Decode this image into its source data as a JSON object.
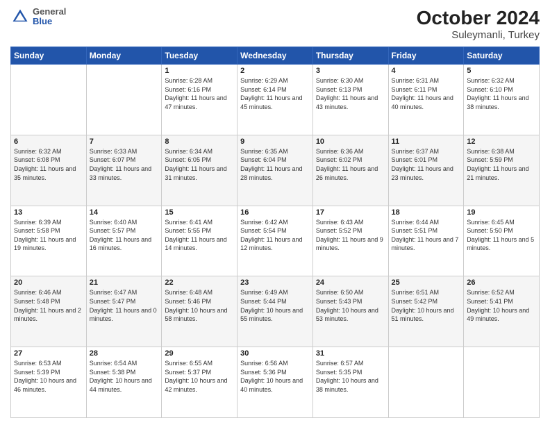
{
  "header": {
    "logo_general": "General",
    "logo_blue": "Blue",
    "title": "October 2024",
    "subtitle": "Suleymanli, Turkey"
  },
  "weekdays": [
    "Sunday",
    "Monday",
    "Tuesday",
    "Wednesday",
    "Thursday",
    "Friday",
    "Saturday"
  ],
  "weeks": [
    [
      {
        "day": "",
        "info": ""
      },
      {
        "day": "",
        "info": ""
      },
      {
        "day": "1",
        "info": "Sunrise: 6:28 AM\nSunset: 6:16 PM\nDaylight: 11 hours and 47 minutes."
      },
      {
        "day": "2",
        "info": "Sunrise: 6:29 AM\nSunset: 6:14 PM\nDaylight: 11 hours and 45 minutes."
      },
      {
        "day": "3",
        "info": "Sunrise: 6:30 AM\nSunset: 6:13 PM\nDaylight: 11 hours and 43 minutes."
      },
      {
        "day": "4",
        "info": "Sunrise: 6:31 AM\nSunset: 6:11 PM\nDaylight: 11 hours and 40 minutes."
      },
      {
        "day": "5",
        "info": "Sunrise: 6:32 AM\nSunset: 6:10 PM\nDaylight: 11 hours and 38 minutes."
      }
    ],
    [
      {
        "day": "6",
        "info": "Sunrise: 6:32 AM\nSunset: 6:08 PM\nDaylight: 11 hours and 35 minutes."
      },
      {
        "day": "7",
        "info": "Sunrise: 6:33 AM\nSunset: 6:07 PM\nDaylight: 11 hours and 33 minutes."
      },
      {
        "day": "8",
        "info": "Sunrise: 6:34 AM\nSunset: 6:05 PM\nDaylight: 11 hours and 31 minutes."
      },
      {
        "day": "9",
        "info": "Sunrise: 6:35 AM\nSunset: 6:04 PM\nDaylight: 11 hours and 28 minutes."
      },
      {
        "day": "10",
        "info": "Sunrise: 6:36 AM\nSunset: 6:02 PM\nDaylight: 11 hours and 26 minutes."
      },
      {
        "day": "11",
        "info": "Sunrise: 6:37 AM\nSunset: 6:01 PM\nDaylight: 11 hours and 23 minutes."
      },
      {
        "day": "12",
        "info": "Sunrise: 6:38 AM\nSunset: 5:59 PM\nDaylight: 11 hours and 21 minutes."
      }
    ],
    [
      {
        "day": "13",
        "info": "Sunrise: 6:39 AM\nSunset: 5:58 PM\nDaylight: 11 hours and 19 minutes."
      },
      {
        "day": "14",
        "info": "Sunrise: 6:40 AM\nSunset: 5:57 PM\nDaylight: 11 hours and 16 minutes."
      },
      {
        "day": "15",
        "info": "Sunrise: 6:41 AM\nSunset: 5:55 PM\nDaylight: 11 hours and 14 minutes."
      },
      {
        "day": "16",
        "info": "Sunrise: 6:42 AM\nSunset: 5:54 PM\nDaylight: 11 hours and 12 minutes."
      },
      {
        "day": "17",
        "info": "Sunrise: 6:43 AM\nSunset: 5:52 PM\nDaylight: 11 hours and 9 minutes."
      },
      {
        "day": "18",
        "info": "Sunrise: 6:44 AM\nSunset: 5:51 PM\nDaylight: 11 hours and 7 minutes."
      },
      {
        "day": "19",
        "info": "Sunrise: 6:45 AM\nSunset: 5:50 PM\nDaylight: 11 hours and 5 minutes."
      }
    ],
    [
      {
        "day": "20",
        "info": "Sunrise: 6:46 AM\nSunset: 5:48 PM\nDaylight: 11 hours and 2 minutes."
      },
      {
        "day": "21",
        "info": "Sunrise: 6:47 AM\nSunset: 5:47 PM\nDaylight: 11 hours and 0 minutes."
      },
      {
        "day": "22",
        "info": "Sunrise: 6:48 AM\nSunset: 5:46 PM\nDaylight: 10 hours and 58 minutes."
      },
      {
        "day": "23",
        "info": "Sunrise: 6:49 AM\nSunset: 5:44 PM\nDaylight: 10 hours and 55 minutes."
      },
      {
        "day": "24",
        "info": "Sunrise: 6:50 AM\nSunset: 5:43 PM\nDaylight: 10 hours and 53 minutes."
      },
      {
        "day": "25",
        "info": "Sunrise: 6:51 AM\nSunset: 5:42 PM\nDaylight: 10 hours and 51 minutes."
      },
      {
        "day": "26",
        "info": "Sunrise: 6:52 AM\nSunset: 5:41 PM\nDaylight: 10 hours and 49 minutes."
      }
    ],
    [
      {
        "day": "27",
        "info": "Sunrise: 6:53 AM\nSunset: 5:39 PM\nDaylight: 10 hours and 46 minutes."
      },
      {
        "day": "28",
        "info": "Sunrise: 6:54 AM\nSunset: 5:38 PM\nDaylight: 10 hours and 44 minutes."
      },
      {
        "day": "29",
        "info": "Sunrise: 6:55 AM\nSunset: 5:37 PM\nDaylight: 10 hours and 42 minutes."
      },
      {
        "day": "30",
        "info": "Sunrise: 6:56 AM\nSunset: 5:36 PM\nDaylight: 10 hours and 40 minutes."
      },
      {
        "day": "31",
        "info": "Sunrise: 6:57 AM\nSunset: 5:35 PM\nDaylight: 10 hours and 38 minutes."
      },
      {
        "day": "",
        "info": ""
      },
      {
        "day": "",
        "info": ""
      }
    ]
  ]
}
